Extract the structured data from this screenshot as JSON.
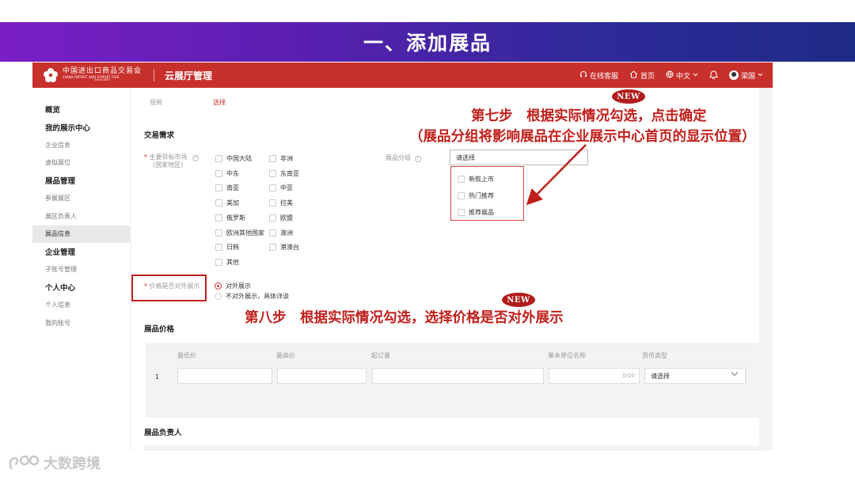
{
  "slide": {
    "title": "一、添加展品"
  },
  "header": {
    "logo_cn": "中国进出口商品交易会",
    "logo_en": "CHINA IMPORT AND EXPORT FAIR",
    "logo_since": "Since 1957",
    "app_title": "云展厅管理",
    "online_service": "在线客服",
    "home": "首页",
    "language": "中文",
    "user": "梁国"
  },
  "sidebar": {
    "items": [
      {
        "label": "概览",
        "type": "section"
      },
      {
        "label": "我的展示中心",
        "type": "section"
      },
      {
        "label": "企业信息",
        "type": "item"
      },
      {
        "label": "虚拟展位",
        "type": "item"
      },
      {
        "label": "展品管理",
        "type": "section"
      },
      {
        "label": "参展展区",
        "type": "item"
      },
      {
        "label": "展区负责人",
        "type": "item"
      },
      {
        "label": "展品信息",
        "type": "active"
      },
      {
        "label": "企业管理",
        "type": "section"
      },
      {
        "label": "子账号管理",
        "type": "item"
      },
      {
        "label": "个人中心",
        "type": "section"
      },
      {
        "label": "个人信息",
        "type": "item"
      },
      {
        "label": "我的账号",
        "type": "item"
      }
    ]
  },
  "form": {
    "video_label": "视频",
    "video_select": "选择",
    "trade_section": "交易需求",
    "market_label_1": "主要目标市场",
    "market_label_2": "(国家地区)",
    "markets": [
      "中国大陆",
      "非洲",
      "中东",
      "东南亚",
      "南亚",
      "中亚",
      "美加",
      "拉美",
      "俄罗斯",
      "欧盟",
      "欧洲其他国家",
      "澳洲",
      "日韩",
      "港澳台",
      "其他"
    ],
    "group_label": "展品分组",
    "group_placeholder": "请选择",
    "group_options": [
      "新款上市",
      "热门推荐",
      "推荐展品"
    ],
    "price_visible_label": "价格是否对外展示",
    "price_options": [
      "对外展示",
      "不对外展示，具体详谈"
    ],
    "price_section": "展品价格",
    "price_columns": [
      "最低价",
      "最高价",
      "起订量",
      "基本单位名称",
      "货币类型"
    ],
    "row_index": "1",
    "unit_counter": "0/20",
    "currency_placeholder": "请选择",
    "owner_section": "展品负责人"
  },
  "annotations": {
    "new_badge": "NEW",
    "step7_line1": "第七步　根据实际情况勾选，点击确定",
    "step7_line2": "（展品分组将影响展品在企业展示中心首页的显示位置）",
    "step8": "第八步　根据实际情况勾选，选择价格是否对外展示",
    "accent": "#c0201c"
  },
  "watermark": {
    "text": "大数跨境"
  }
}
